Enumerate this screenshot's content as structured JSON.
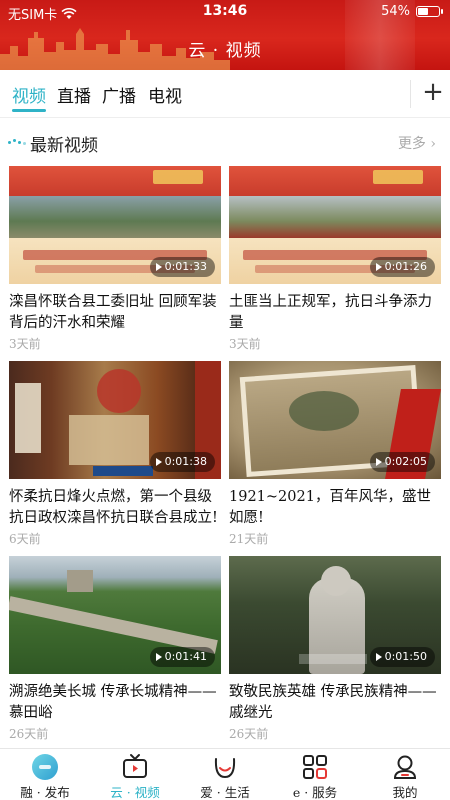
{
  "status_bar": {
    "carrier": "无SIM卡",
    "time": "13:46",
    "battery": "54%",
    "battery_level": 0.54
  },
  "header": {
    "title": "云 · 视频"
  },
  "tabs": [
    {
      "label": "视频",
      "active": true
    },
    {
      "label": "直播",
      "active": false
    },
    {
      "label": "广播",
      "active": false
    },
    {
      "label": "电视",
      "active": false
    }
  ],
  "section": {
    "title": "最新视频",
    "more_label": "更多"
  },
  "videos": [
    {
      "title": "滦昌怀联合县工委旧址 回顾军装背后的汗水和荣耀",
      "duration": "0:01:33",
      "posted": "3天前"
    },
    {
      "title": "土匪当上正规军，抗日斗争添力量",
      "duration": "0:01:26",
      "posted": "3天前"
    },
    {
      "title": "怀柔抗日烽火点燃，第一个县级抗日政权滦昌怀抗日联合县成立!",
      "duration": "0:01:38",
      "posted": "6天前"
    },
    {
      "title": "1921~2021，百年风华，盛世如愿!",
      "duration": "0:02:05",
      "posted": "21天前"
    },
    {
      "title": "溯源绝美长城 传承长城精神——慕田峪",
      "duration": "0:01:41",
      "posted": "26天前"
    },
    {
      "title": "致敬民族英雄 传承民族精神——戚继光",
      "duration": "0:01:50",
      "posted": "26天前"
    }
  ],
  "bottom_nav": [
    {
      "label": "融 · 发布",
      "icon": "publish-icon",
      "active": false
    },
    {
      "label": "云 · 视频",
      "icon": "tv-icon",
      "active": true
    },
    {
      "label": "爱 · 生活",
      "icon": "smile-icon",
      "active": false
    },
    {
      "label": "e · 服务",
      "icon": "grid-icon",
      "active": false
    },
    {
      "label": "我的",
      "icon": "user-icon",
      "active": false
    }
  ],
  "colors": {
    "accent": "#2fb3c7",
    "header_red": "#d9271d"
  }
}
